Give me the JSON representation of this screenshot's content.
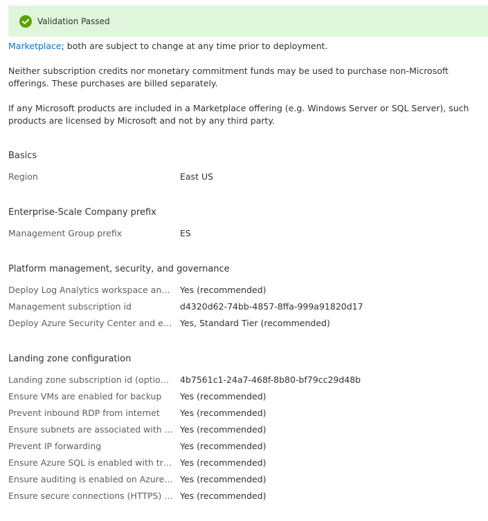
{
  "banner": {
    "text": "Validation Passed",
    "icon": "check-circle-icon",
    "color": "#dff6dd",
    "icon_color": "#57a300"
  },
  "terms": {
    "marketplace_link": "Marketplace",
    "marketplace_tail": "; both are subject to change at any time prior to deployment.",
    "para2": "Neither subscription credits nor monetary commitment funds may be used to purchase non-Microsoft offerings. These purchases are billed separately.",
    "para3": "If any Microsoft products are included in a Marketplace offering (e.g. Windows Server or SQL Server), such products are licensed by Microsoft and not by any third party."
  },
  "sections": {
    "basics": {
      "title": "Basics",
      "rows": [
        {
          "label": "Region",
          "value": "East US"
        }
      ]
    },
    "prefix": {
      "title": "Enterprise-Scale Company prefix",
      "rows": [
        {
          "label": "Management Group prefix",
          "value": "ES"
        }
      ]
    },
    "platform": {
      "title": "Platform management, security, and governance",
      "rows": [
        {
          "label": "Deploy Log Analytics workspace and en...",
          "value": "Yes (recommended)"
        },
        {
          "label": "Management subscription id",
          "value": "d4320d62-74bb-4857-8ffa-999a91820d17"
        },
        {
          "label": "Deploy Azure Security Center and enabl...",
          "value": "Yes, Standard Tier (recommended)"
        }
      ]
    },
    "landing": {
      "title": "Landing zone configuration",
      "rows": [
        {
          "label": "Landing zone subscription id (optional)",
          "value": "4b7561c1-24a7-468f-8b80-bf79cc29d48b"
        },
        {
          "label": "Ensure VMs are enabled for backup",
          "value": "Yes (recommended)"
        },
        {
          "label": "Prevent inbound RDP from internet",
          "value": "Yes (recommended)"
        },
        {
          "label": "Ensure subnets are associated with NSG",
          "value": "Yes (recommended)"
        },
        {
          "label": "Prevent IP forwarding",
          "value": "Yes (recommended)"
        },
        {
          "label": "Ensure Azure SQL is enabled with transp...",
          "value": "Yes (recommended)"
        },
        {
          "label": "Ensure auditing is enabled on Azure SQL",
          "value": "Yes (recommended)"
        },
        {
          "label": "Ensure secure connections (HTTPS) to st...",
          "value": "Yes (recommended)"
        }
      ]
    }
  }
}
